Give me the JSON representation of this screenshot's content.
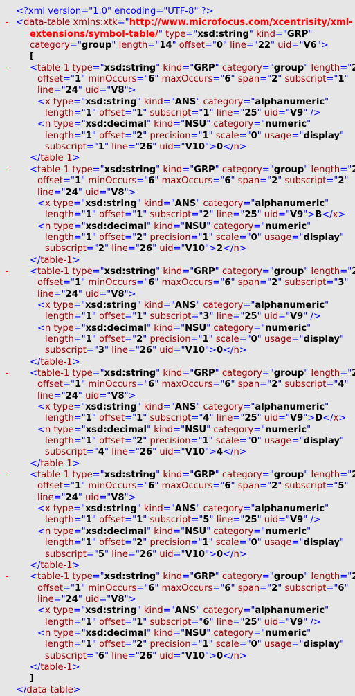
{
  "xml_declaration": "<?xml version=\"1.0\" encoding=\"UTF-8\" ?>",
  "collapse_marker": "-",
  "root": {
    "tag": "data-table",
    "xmlns_attr": "xmlns:xtk",
    "xmlns_value_line1": "http://www.microfocus.com/xcentrisity/xml-",
    "xmlns_value_line2": "extensions/symbol-table/",
    "type": "xsd:string",
    "kind": "GRP",
    "category": "group",
    "length": "14",
    "offset": "0",
    "line": "22",
    "uid": "V6",
    "open_bracket": "[",
    "close_bracket": "]"
  },
  "tables": [
    {
      "subscript": "1",
      "x_value": "",
      "n_value": "0"
    },
    {
      "subscript": "2",
      "x_value": "B",
      "n_value": "2"
    },
    {
      "subscript": "3",
      "x_value": "",
      "n_value": "0"
    },
    {
      "subscript": "4",
      "x_value": "D",
      "n_value": "4"
    },
    {
      "subscript": "5",
      "x_value": "",
      "n_value": "0"
    },
    {
      "subscript": "6",
      "x_value": "",
      "n_value": "0"
    }
  ],
  "table_common": {
    "tag": "table-1",
    "type": "xsd:string",
    "kind": "GRP",
    "category": "group",
    "length": "2",
    "offset": "1",
    "minOccurs": "6",
    "maxOccurs": "6",
    "span": "2",
    "line": "24",
    "uid": "V8"
  },
  "x_common": {
    "tag": "x",
    "type": "xsd:string",
    "kind": "ANS",
    "category": "alphanumeric",
    "length": "1",
    "offset": "1",
    "line": "25",
    "uid": "V9"
  },
  "n_common": {
    "tag": "n",
    "type": "xsd:decimal",
    "kind": "NSU",
    "category": "numeric",
    "length": "1",
    "offset": "2",
    "precision": "1",
    "scale": "0",
    "usage": "display",
    "line": "26",
    "uid": "V10"
  },
  "colors": {
    "background": "#e6e6e6",
    "markup": "#0000ff",
    "names": "#990000",
    "collapse": "#ff0000",
    "url": "#ff0000"
  }
}
